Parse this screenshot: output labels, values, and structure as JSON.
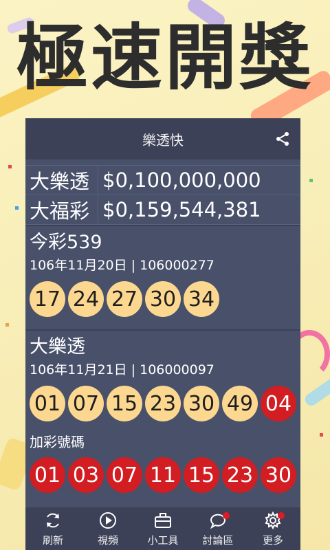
{
  "headline": "極速開獎",
  "app": {
    "title": "樂透快"
  },
  "jackpots": [
    {
      "name": "大樂透",
      "amount": "$0,100,000,000"
    },
    {
      "name": "大福彩",
      "amount": "$0,159,544,381"
    }
  ],
  "draw539": {
    "title": "今彩539",
    "date": "106年11月20日 | 106000277",
    "numbers": [
      "17",
      "24",
      "27",
      "30",
      "34"
    ]
  },
  "lotto": {
    "title": "大樂透",
    "date": "106年11月21日 | 106000097",
    "numbers": [
      "01",
      "07",
      "15",
      "23",
      "30",
      "49"
    ],
    "special": "04",
    "extra_label": "加彩號碼",
    "extra_numbers": [
      "01",
      "03",
      "07",
      "11",
      "15",
      "23",
      "30"
    ]
  },
  "nav": [
    {
      "label": "刷新",
      "icon": "refresh-icon"
    },
    {
      "label": "視頻",
      "icon": "play-icon"
    },
    {
      "label": "小工具",
      "icon": "toolbox-icon"
    },
    {
      "label": "討論區",
      "icon": "chat-icon"
    },
    {
      "label": "更多",
      "icon": "gear-icon"
    }
  ],
  "colors": {
    "ball_yellow": "#fcd78f",
    "ball_red": "#d21d22",
    "panel": "#48506a",
    "bar": "#3c4157"
  }
}
